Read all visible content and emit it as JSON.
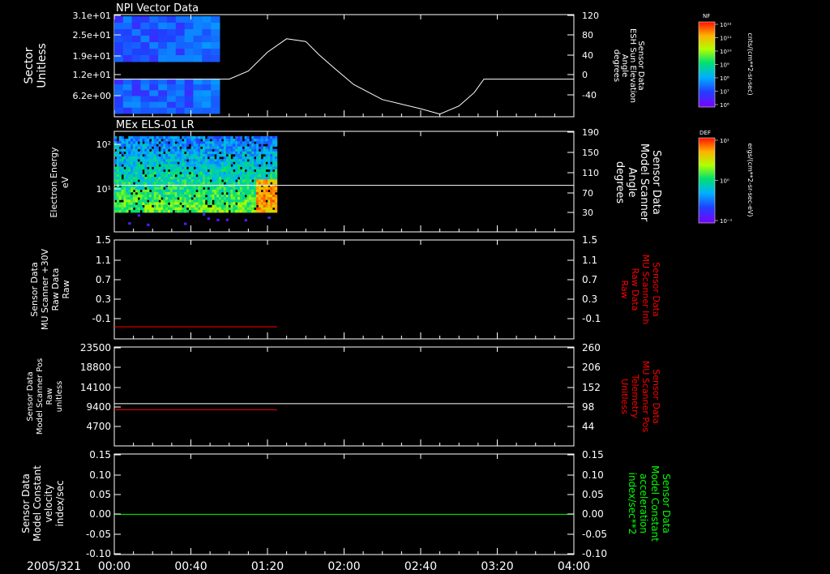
{
  "time_axis": {
    "date_label": "2005/321",
    "ticks": [
      "00:00",
      "00:40",
      "01:20",
      "02:00",
      "02:40",
      "03:20",
      "04:00"
    ],
    "range_minutes": [
      0,
      240
    ]
  },
  "colors": {
    "background": "#000000",
    "foreground": "#ffffff",
    "red_label": "#ff0000",
    "green_label": "#00ff00",
    "red_trace": "#ff0000",
    "green_trace": "#00ff00"
  },
  "panels": [
    {
      "id": "npi",
      "title": "NPI Vector Data",
      "left_label": [
        "Sector",
        "Unitless"
      ],
      "left_ticks": [
        "3.1e+01",
        "2.5e+01",
        "1.9e+01",
        "1.2e+01",
        "6.2e+00"
      ],
      "right_label": [
        "Sensor Data",
        "ESH Sun Elevation",
        "Angle",
        "degrees"
      ],
      "right_ticks": [
        "120",
        "80",
        "40",
        "0",
        "-40"
      ],
      "colorbar": {
        "name": "NF",
        "unit": "cnts/(cm**2-sr-sec)",
        "ticks": [
          "10¹²",
          "10¹¹",
          "10¹⁰",
          "10⁹",
          "10⁸",
          "10⁷",
          "10⁶"
        ]
      }
    },
    {
      "id": "els",
      "title": "MEx ELS-01 LR",
      "left_label": [
        "Electron Energy",
        "eV"
      ],
      "left_ticks": [
        "10²",
        "10¹"
      ],
      "right_label": [
        "Sensor Data",
        "Model Scanner",
        "Angle",
        "degrees"
      ],
      "right_ticks": [
        "190",
        "150",
        "110",
        "70",
        "30"
      ],
      "colorbar": {
        "name": "DEF",
        "unit": "ergs/(cm**2-sr-sec-eV)",
        "ticks": [
          "10¹",
          "10⁰",
          "10⁻¹"
        ]
      }
    },
    {
      "id": "mu_scanner",
      "left_label": [
        "Sensor Data",
        "MU Scanner +30V",
        "Raw Data",
        "Raw"
      ],
      "left_ticks": [
        "1.5",
        "1.1",
        "0.7",
        "0.3",
        "-0.1"
      ],
      "right_label": [
        "Sensor Data",
        "MU Scanner Inh",
        "Raw Data",
        "Raw"
      ],
      "right_ticks": [
        "1.5",
        "1.1",
        "0.7",
        "0.3",
        "-0.1"
      ]
    },
    {
      "id": "scanner_pos",
      "left_label": [
        "Sensor Data",
        "Model Scanner Pos",
        "Raw",
        "unitless"
      ],
      "left_ticks": [
        "23500",
        "18800",
        "14100",
        "9400",
        "4700"
      ],
      "right_label": [
        "Sensor Data",
        "MU Scanner Pos",
        "Telemetry",
        "Unitless"
      ],
      "right_ticks": [
        "260",
        "206",
        "152",
        "98",
        "44"
      ]
    },
    {
      "id": "velocity",
      "left_label": [
        "Sensor Data",
        "Model Constant",
        "velocity",
        "index/sec"
      ],
      "left_ticks": [
        "0.15",
        "0.10",
        "0.05",
        "0.00",
        "-0.05",
        "-0.10"
      ],
      "right_label": [
        "Sensor Data",
        "Model Constant",
        "acceleration",
        "index/sec**2"
      ],
      "right_ticks": [
        "0.15",
        "0.10",
        "0.05",
        "0.00",
        "-0.05",
        "-0.10"
      ]
    }
  ],
  "chart_data": [
    {
      "type": "heatmap",
      "title": "NPI Vector Data",
      "ylabel": "Sector",
      "yunit": "Unitless",
      "x_extent_minutes": [
        0,
        55
      ],
      "overlay_line": {
        "name": "ESH Sun Elevation Angle",
        "unit": "degrees",
        "ylim": [
          -70,
          120
        ],
        "x": [
          0,
          60,
          70,
          80,
          90,
          100,
          107,
          115,
          125,
          140,
          160,
          170,
          180,
          188,
          193,
          200,
          240
        ],
        "y": [
          0,
          0,
          15,
          50,
          75,
          70,
          45,
          20,
          -10,
          -38,
          -55,
          -65,
          -50,
          -25,
          0,
          0,
          0
        ]
      }
    },
    {
      "type": "heatmap",
      "title": "MEx ELS-01 LR",
      "ylabel": "Electron Energy",
      "yunit": "eV",
      "yscale": "log",
      "x_extent_minutes": [
        0,
        85
      ],
      "overlay_line": {
        "name": "Model Scanner Angle",
        "unit": "degrees",
        "ylim": [
          0,
          190
        ],
        "constant": 88
      }
    },
    {
      "type": "line",
      "series": [
        {
          "name": "MU Scanner +30V Raw Data",
          "x": [
            0,
            85
          ],
          "y": [
            -0.08,
            -0.08
          ]
        }
      ],
      "ylim": [
        -0.3,
        1.5
      ]
    },
    {
      "type": "line",
      "series": [
        {
          "name": "Model Scanner Pos",
          "x": [
            0,
            85
          ],
          "y": [
            8600,
            8600
          ]
        },
        {
          "name": "MU Scanner Pos Telemetry",
          "x": [
            0,
            240
          ],
          "y": [
            111,
            111
          ]
        }
      ],
      "ylim_left": [
        0,
        23500
      ],
      "ylim_right": [
        0,
        260
      ]
    },
    {
      "type": "line",
      "series": [
        {
          "name": "Model Constant velocity",
          "x": [
            0,
            240
          ],
          "y": [
            0.0,
            0.0
          ]
        }
      ],
      "ylim": [
        -0.1,
        0.15
      ]
    }
  ]
}
